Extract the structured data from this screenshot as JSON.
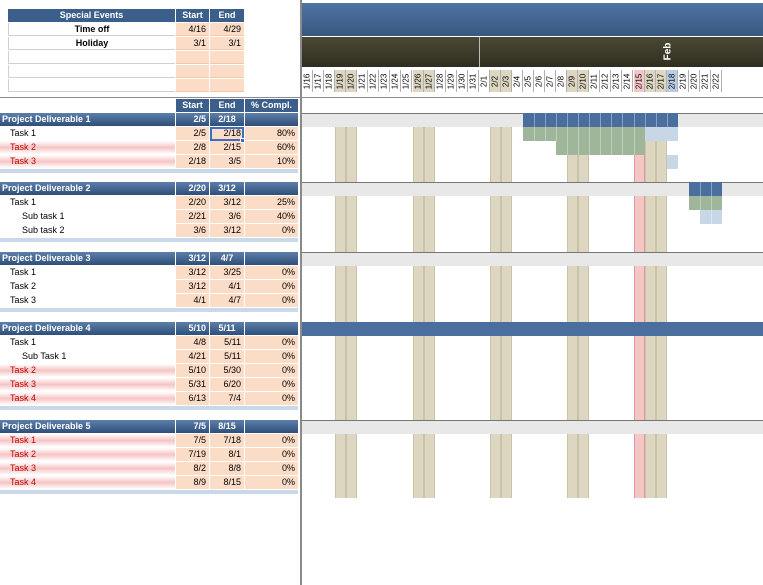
{
  "special_events": {
    "header": [
      "Special Events",
      "Start",
      "End"
    ],
    "rows": [
      {
        "name": "Time off",
        "start": "4/16",
        "end": "4/29"
      },
      {
        "name": "Holiday",
        "start": "3/1",
        "end": "3/1"
      },
      {
        "name": "",
        "start": "",
        "end": ""
      },
      {
        "name": "",
        "start": "",
        "end": ""
      },
      {
        "name": "",
        "start": "",
        "end": ""
      }
    ]
  },
  "columns": {
    "start": "Start",
    "end": "End",
    "pct": "% Compl."
  },
  "month_label": "Feb",
  "dates": [
    "1/16",
    "1/17",
    "1/18",
    "1/19",
    "1/20",
    "1/21",
    "1/22",
    "1/23",
    "1/24",
    "1/25",
    "1/26",
    "1/27",
    "1/28",
    "1/29",
    "1/30",
    "1/31",
    "2/1",
    "2/2",
    "2/3",
    "2/4",
    "2/5",
    "2/6",
    "2/7",
    "2/8",
    "2/9",
    "2/10",
    "2/11",
    "2/12",
    "2/13",
    "2/14",
    "2/15",
    "2/16",
    "2/17",
    "2/18",
    "2/19",
    "2/20",
    "2/21",
    "2/22"
  ],
  "weekend_dates": [
    "1/19",
    "1/20",
    "1/26",
    "1/27",
    "2/2",
    "2/3",
    "2/9",
    "2/10",
    "2/16",
    "2/17"
  ],
  "holiday_date": "2/15",
  "today_date": "2/18",
  "deliverables": [
    {
      "name": "Project Deliverable 1",
      "start": "2/5",
      "end": "2/18",
      "tasks": [
        {
          "name": "Task 1",
          "start": "2/5",
          "end": "2/18",
          "pct": "80%",
          "red": false,
          "indent": 1
        },
        {
          "name": "Task 2",
          "start": "2/8",
          "end": "2/15",
          "pct": "60%",
          "red": true,
          "indent": 1
        },
        {
          "name": "Task 3",
          "start": "2/18",
          "end": "3/5",
          "pct": "10%",
          "red": true,
          "indent": 1
        }
      ]
    },
    {
      "name": "Project Deliverable 2",
      "start": "2/20",
      "end": "3/12",
      "tasks": [
        {
          "name": "Task 1",
          "start": "2/20",
          "end": "3/12",
          "pct": "25%",
          "red": false,
          "indent": 1
        },
        {
          "name": "Sub task 1",
          "start": "2/21",
          "end": "3/6",
          "pct": "40%",
          "red": false,
          "indent": 2
        },
        {
          "name": "Sub task 2",
          "start": "3/6",
          "end": "3/12",
          "pct": "0%",
          "red": false,
          "indent": 2
        }
      ]
    },
    {
      "name": "Project Deliverable 3",
      "start": "3/12",
      "end": "4/7",
      "tasks": [
        {
          "name": "Task 1",
          "start": "3/12",
          "end": "3/25",
          "pct": "0%",
          "red": false,
          "indent": 1
        },
        {
          "name": "Task 2",
          "start": "3/12",
          "end": "4/1",
          "pct": "0%",
          "red": false,
          "indent": 1
        },
        {
          "name": "Task 3",
          "start": "4/1",
          "end": "4/7",
          "pct": "0%",
          "red": false,
          "indent": 1
        }
      ]
    },
    {
      "name": "Project Deliverable 4",
      "start": "5/10",
      "end": "5/11",
      "tasks": [
        {
          "name": "Task 1",
          "start": "4/8",
          "end": "5/11",
          "pct": "0%",
          "red": false,
          "indent": 1
        },
        {
          "name": "Sub Task 1",
          "start": "4/21",
          "end": "5/11",
          "pct": "0%",
          "red": false,
          "indent": 2
        },
        {
          "name": "Task 2",
          "start": "5/10",
          "end": "5/30",
          "pct": "0%",
          "red": true,
          "indent": 1
        },
        {
          "name": "Task 3",
          "start": "5/31",
          "end": "6/20",
          "pct": "0%",
          "red": true,
          "indent": 1
        },
        {
          "name": "Task 4",
          "start": "6/13",
          "end": "7/4",
          "pct": "0%",
          "red": true,
          "indent": 1
        }
      ]
    },
    {
      "name": "Project Deliverable 5",
      "start": "7/5",
      "end": "8/15",
      "tasks": [
        {
          "name": "Task 1",
          "start": "7/5",
          "end": "7/18",
          "pct": "0%",
          "red": true,
          "indent": 1
        },
        {
          "name": "Task 2",
          "start": "7/19",
          "end": "8/1",
          "pct": "0%",
          "red": true,
          "indent": 1
        },
        {
          "name": "Task 3",
          "start": "8/2",
          "end": "8/8",
          "pct": "0%",
          "red": true,
          "indent": 1
        },
        {
          "name": "Task 4",
          "start": "8/9",
          "end": "8/15",
          "pct": "0%",
          "red": true,
          "indent": 1
        }
      ]
    }
  ],
  "colors": {
    "header_blue": "#3b5e8a",
    "peach": "#fbdcc6",
    "weekend": "#ddd6c0",
    "holiday": "#f4c6c6",
    "bar_blue": "#4a6f9e",
    "bar_green": "#9fb69a",
    "bar_light": "#c7d7e6",
    "month_band": "#3d3b2a"
  }
}
